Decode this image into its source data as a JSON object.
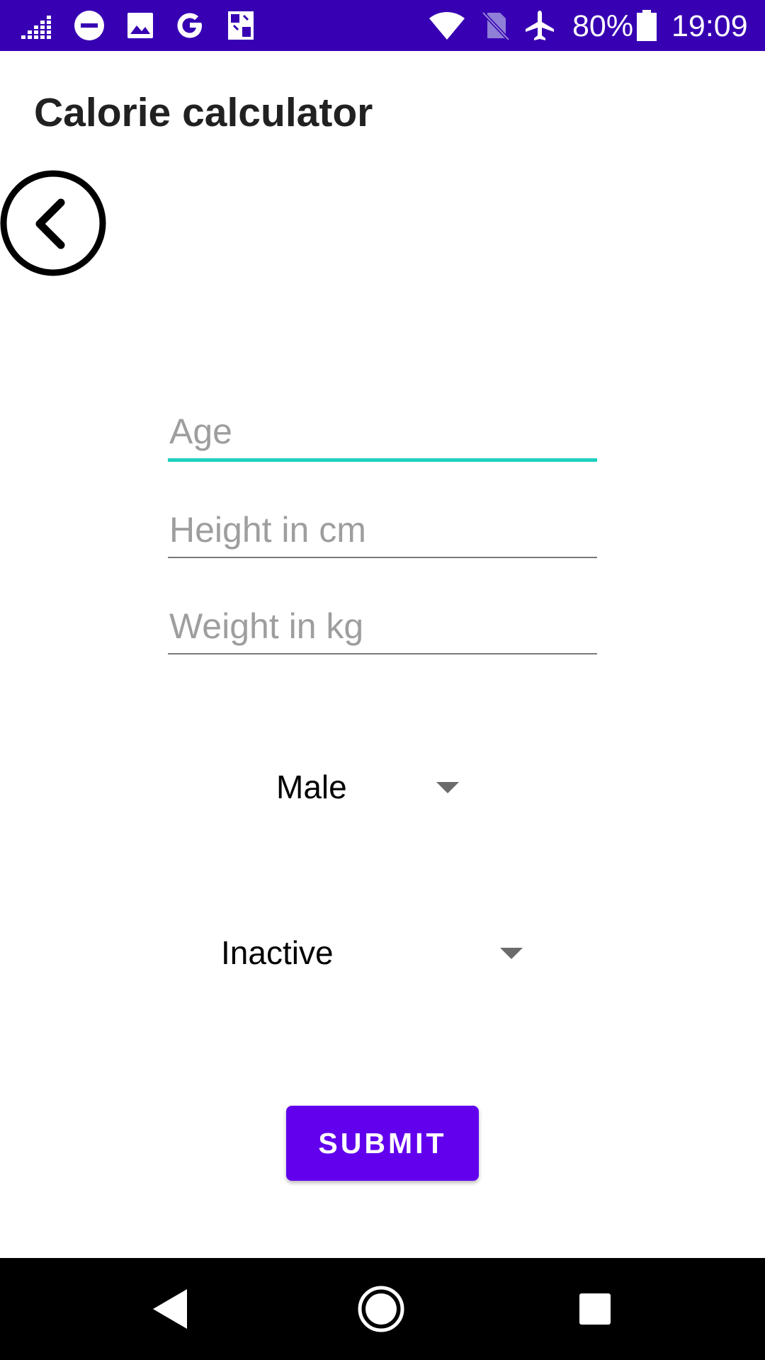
{
  "status_bar": {
    "battery": "80%",
    "time": "19:09",
    "icons": [
      "signal-bars-icon",
      "do-not-disturb-icon",
      "image-icon",
      "google-icon",
      "screenshot-icon",
      "wifi-icon",
      "no-sim-icon",
      "airplane-mode-icon",
      "battery-icon"
    ]
  },
  "header": {
    "title": "Calorie calculator"
  },
  "back_button": {
    "icon": "back-circle-icon"
  },
  "form": {
    "age": {
      "placeholder": "Age",
      "value": ""
    },
    "height": {
      "placeholder": "Height in cm",
      "value": ""
    },
    "weight": {
      "placeholder": "Weight in kg",
      "value": ""
    },
    "gender": {
      "selected": "Male"
    },
    "activity": {
      "selected": "Inactive"
    },
    "submit_label": "SUBMIT"
  },
  "colors": {
    "status_bar": "#3700b3",
    "accent": "#1fd0bf",
    "button": "#6200ee",
    "nav_bar": "#000000"
  },
  "nav_bar": {
    "icons": [
      "nav-back-icon",
      "nav-home-icon",
      "nav-recents-icon"
    ]
  }
}
